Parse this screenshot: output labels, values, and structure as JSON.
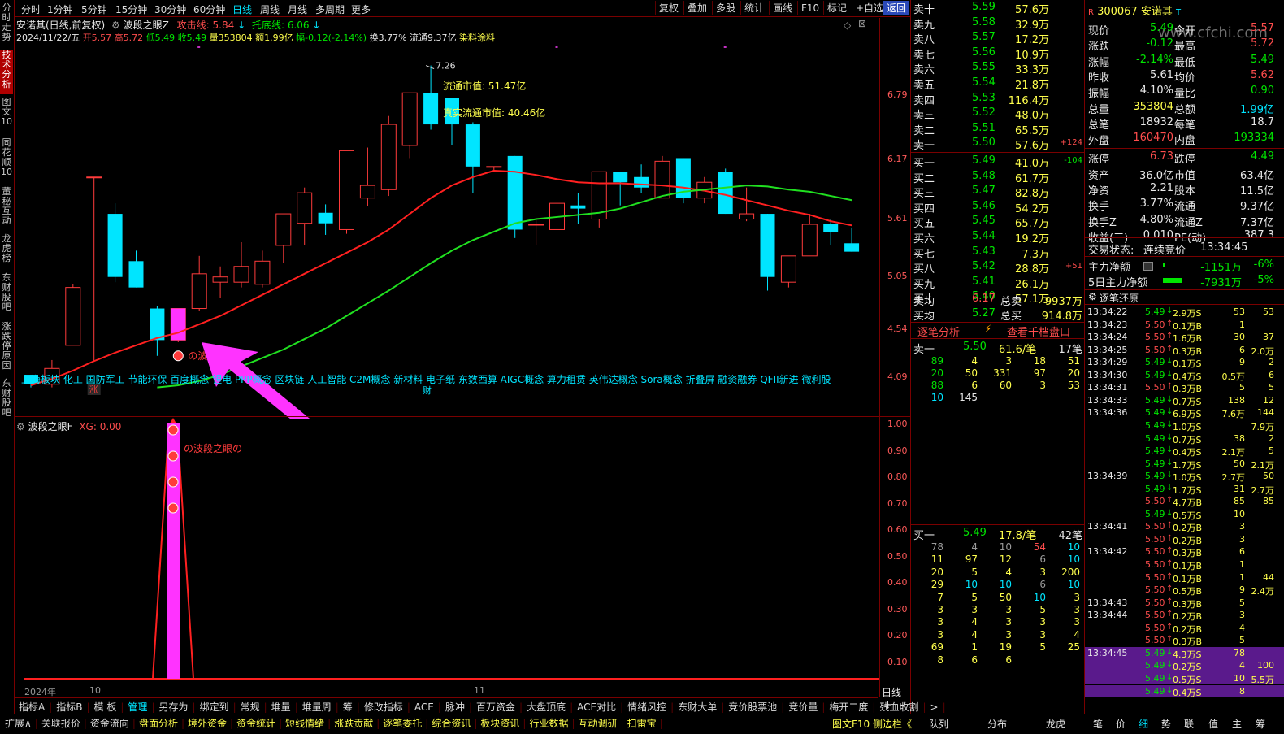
{
  "left_tabs": [
    "分时走势",
    "技术分析",
    "图文10",
    "同花顺10",
    "董秘互动",
    "龙虎榜",
    "东财股吧",
    "涨跌停原因",
    "东财股吧"
  ],
  "period_buttons": [
    "分时",
    "1分钟",
    "5分钟",
    "15分钟",
    "30分钟",
    "60分钟",
    "日线",
    "周线",
    "月线",
    "多周期",
    "更多"
  ],
  "right_buttons": [
    "复权",
    "叠加",
    "多股",
    "统计",
    "画线",
    "F10",
    "标记",
    "+自选",
    "返回"
  ],
  "stock_header": {
    "name": "安诺其(日线,前复权)",
    "indicator": "波段之眼Z",
    "attack_label": "攻击线: 5.84",
    "support_label": "托底线: 6.06",
    "date": "2024/11/22/五",
    "open": "开5.57",
    "high": "高5.72",
    "low": "低5.49",
    "close": "收5.49",
    "volume": "量353804",
    "amount": "额1.99亿",
    "change": "幅-0.12(-2.14%)",
    "turnover": "换3.77%",
    "float": "流通9.37亿",
    "concept": "染料涂料"
  },
  "annotations": {
    "float_mv": "流通市值: 51.47亿",
    "real_float_mv": "真实流通市值: 40.46亿",
    "high_mark": "7.26",
    "signal": "の波段之眼の",
    "zhang": "涨",
    "lower_panel_title": "波段之眼F",
    "lower_panel_xg": "XG: 0.00",
    "year": "2024年",
    "month_oct": "10",
    "month_nov": "11",
    "period": "日线"
  },
  "concepts_line": "上海板块 化工 国防军工 节能环保 百度概念 锂电 PPP概念 区块链 人工智能 C2M概念 新材料 电子纸 东数西算 AIGC概念 算力租赁 英伟达概念 Sora概念 折叠屏 融资融券 QFII新进 微利股",
  "concepts_line2": "财",
  "price_axis": [
    "6.79",
    "6.17",
    "5.61",
    "5.05",
    "4.54",
    "4.09"
  ],
  "lower_axis": [
    "1.00",
    "0.90",
    "0.80",
    "0.70",
    "0.60",
    "0.50",
    "0.40",
    "0.30",
    "0.20",
    "0.10"
  ],
  "candles": [
    {
      "o": 4.32,
      "c": 4.23,
      "h": 4.32,
      "l": 4.2
    },
    {
      "o": 4.23,
      "c": 4.38,
      "h": 4.46,
      "l": 4.2
    },
    {
      "o": 4.6,
      "c": 5.15,
      "h": 5.18,
      "l": 4.6
    },
    {
      "o": 6.2,
      "c": 6.2,
      "h": 6.2,
      "l": 4.45
    },
    {
      "o": 5.85,
      "c": 5.25,
      "h": 5.95,
      "l": 5.2
    },
    {
      "o": 5.4,
      "c": 5.15,
      "h": 5.5,
      "l": 5.15
    },
    {
      "o": 4.95,
      "c": 4.65,
      "h": 4.97,
      "l": 4.5
    },
    {
      "o": 4.65,
      "c": 4.95,
      "h": 4.95,
      "l": 4.63
    },
    {
      "o": 4.95,
      "c": 5.28,
      "h": 5.45,
      "l": 4.93
    },
    {
      "o": 5.2,
      "c": 5.25,
      "h": 5.35,
      "l": 5.05
    },
    {
      "o": 5.2,
      "c": 5.35,
      "h": 5.58,
      "l": 5.15
    },
    {
      "o": 5.18,
      "c": 5.4,
      "h": 5.5,
      "l": 5.15
    },
    {
      "o": 5.55,
      "c": 5.85,
      "h": 5.85,
      "l": 5.38
    },
    {
      "o": 5.76,
      "c": 6.05,
      "h": 6.1,
      "l": 5.55
    },
    {
      "o": 5.86,
      "c": 5.76,
      "h": 5.94,
      "l": 5.65
    },
    {
      "o": 5.7,
      "c": 6.45,
      "h": 6.45,
      "l": 5.66
    },
    {
      "o": 6.0,
      "c": 6.12,
      "h": 6.48,
      "l": 5.92
    },
    {
      "o": 6.08,
      "c": 6.7,
      "h": 6.78,
      "l": 6.02
    },
    {
      "o": 6.5,
      "c": 7.0,
      "h": 7.0,
      "l": 6.38
    },
    {
      "o": 7.0,
      "c": 6.7,
      "h": 7.26,
      "l": 6.65
    },
    {
      "o": 6.95,
      "c": 6.7,
      "h": 6.95,
      "l": 6.5
    },
    {
      "o": 6.7,
      "c": 6.3,
      "h": 6.72,
      "l": 6.05
    },
    {
      "o": 6.3,
      "c": 6.3,
      "h": 6.3,
      "l": 6.25
    },
    {
      "o": 6.4,
      "c": 5.7,
      "h": 6.4,
      "l": 5.62
    },
    {
      "o": 5.75,
      "c": 5.75,
      "h": 5.8,
      "l": 5.55
    },
    {
      "o": 5.7,
      "c": 5.95,
      "h": 5.95,
      "l": 5.65
    },
    {
      "o": 5.93,
      "c": 5.9,
      "h": 6.05,
      "l": 5.75
    },
    {
      "o": 5.8,
      "c": 6.25,
      "h": 6.25,
      "l": 5.72
    },
    {
      "o": 6.25,
      "c": 6.15,
      "h": 6.25,
      "l": 5.93
    },
    {
      "o": 6.2,
      "c": 6.1,
      "h": 6.32,
      "l": 6.05
    },
    {
      "o": 6.0,
      "c": 6.35,
      "h": 6.4,
      "l": 6.0
    },
    {
      "o": 6.38,
      "c": 6.0,
      "h": 6.38,
      "l": 5.95
    },
    {
      "o": 6.0,
      "c": 6.15,
      "h": 6.2,
      "l": 5.95
    },
    {
      "o": 6.25,
      "c": 5.85,
      "h": 6.28,
      "l": 5.85
    },
    {
      "o": 5.8,
      "c": 5.85,
      "h": 6.1,
      "l": 5.78
    },
    {
      "o": 5.85,
      "c": 5.25,
      "h": 5.85,
      "l": 5.12
    },
    {
      "o": 5.2,
      "c": 5.45,
      "h": 5.45,
      "l": 5.15
    },
    {
      "o": 5.45,
      "c": 5.75,
      "h": 5.85,
      "l": 5.45
    },
    {
      "o": 5.75,
      "c": 5.68,
      "h": 5.8,
      "l": 5.55
    },
    {
      "o": 5.57,
      "c": 5.49,
      "h": 5.72,
      "l": 5.49
    }
  ],
  "ma_red": [
    4.22,
    4.28,
    4.36,
    4.45,
    4.53,
    4.6,
    4.67,
    4.72,
    4.8,
    4.88,
    4.98,
    5.08,
    5.18,
    5.28,
    5.38,
    5.48,
    5.58,
    5.7,
    5.85,
    6.0,
    6.12,
    6.2,
    6.26,
    6.25,
    6.22,
    6.18,
    6.15,
    6.14,
    6.14,
    6.13,
    6.12,
    6.1,
    6.07,
    6.03,
    5.98,
    5.93,
    5.88,
    5.84,
    5.78,
    5.74
  ],
  "ma_green": [
    null,
    null,
    null,
    null,
    null,
    null,
    4.2,
    4.22,
    4.26,
    4.32,
    4.4,
    4.48,
    4.56,
    4.66,
    4.76,
    4.88,
    5.0,
    5.12,
    5.25,
    5.38,
    5.5,
    5.6,
    5.68,
    5.76,
    5.8,
    5.82,
    5.84,
    5.86,
    5.9,
    5.96,
    6.02,
    6.06,
    6.08,
    6.1,
    6.12,
    6.11,
    6.08,
    6.06,
    6.02,
    5.98
  ],
  "quote": {
    "code": "300067",
    "name": "安诺其",
    "sell": [
      {
        "label": "卖十",
        "price": "5.59",
        "vol": "57.6万",
        "chg": ""
      },
      {
        "label": "卖九",
        "price": "5.58",
        "vol": "32.9万",
        "chg": ""
      },
      {
        "label": "卖八",
        "price": "5.57",
        "vol": "17.2万",
        "chg": ""
      },
      {
        "label": "卖七",
        "price": "5.56",
        "vol": "10.9万",
        "chg": ""
      },
      {
        "label": "卖六",
        "price": "5.55",
        "vol": "33.3万",
        "chg": ""
      },
      {
        "label": "卖五",
        "price": "5.54",
        "vol": "21.8万",
        "chg": ""
      },
      {
        "label": "卖四",
        "price": "5.53",
        "vol": "116.4万",
        "chg": ""
      },
      {
        "label": "卖三",
        "price": "5.52",
        "vol": "48.0万",
        "chg": ""
      },
      {
        "label": "卖二",
        "price": "5.51",
        "vol": "65.5万",
        "chg": ""
      },
      {
        "label": "卖一",
        "price": "5.50",
        "vol": "57.6万",
        "chg": "+124"
      }
    ],
    "buy": [
      {
        "label": "买一",
        "price": "5.49",
        "vol": "41.0万",
        "chg": "-104"
      },
      {
        "label": "买二",
        "price": "5.48",
        "vol": "61.7万",
        "chg": ""
      },
      {
        "label": "买三",
        "price": "5.47",
        "vol": "82.8万",
        "chg": ""
      },
      {
        "label": "买四",
        "price": "5.46",
        "vol": "54.2万",
        "chg": ""
      },
      {
        "label": "买五",
        "price": "5.45",
        "vol": "65.7万",
        "chg": ""
      },
      {
        "label": "买六",
        "price": "5.44",
        "vol": "19.2万",
        "chg": ""
      },
      {
        "label": "买七",
        "price": "5.43",
        "vol": "7.3万",
        "chg": ""
      },
      {
        "label": "买八",
        "price": "5.42",
        "vol": "28.8万",
        "chg": "+51"
      },
      {
        "label": "买九",
        "price": "5.41",
        "vol": "26.1万",
        "chg": ""
      },
      {
        "label": "买十",
        "price": "5.40",
        "vol": "57.1万",
        "chg": ""
      }
    ],
    "avg_sell": {
      "label": "卖均",
      "price": "6.17",
      "tlabel": "总卖",
      "total": "9937万"
    },
    "avg_buy": {
      "label": "买均",
      "price": "5.27",
      "tlabel": "总买",
      "total": "914.8万"
    },
    "tick_links": [
      "逐笔分析",
      "查看千档盘口"
    ],
    "sell1_summary": {
      "label": "卖一",
      "price": "5.50",
      "per": "61.6/笔",
      "count": "17笔"
    },
    "sell1_queue": [
      [
        "89",
        "4",
        "3",
        "18",
        "51"
      ],
      [
        "20",
        "50",
        "331",
        "97",
        "20"
      ],
      [
        "88",
        "6",
        "60",
        "3",
        "53"
      ],
      [
        "10",
        "145",
        "",
        "",
        ""
      ]
    ],
    "buy1_summary": {
      "label": "买一",
      "price": "5.49",
      "per": "17.8/笔",
      "count": "42笔"
    },
    "buy1_queue": [
      [
        "78",
        "4",
        "10",
        "54",
        "10"
      ],
      [
        "11",
        "97",
        "12",
        "6",
        "10"
      ],
      [
        "20",
        "5",
        "4",
        "3",
        "200"
      ],
      [
        "29",
        "10",
        "10",
        "6",
        "10"
      ],
      [
        "7",
        "5",
        "50",
        "10",
        "3"
      ],
      [
        "3",
        "3",
        "3",
        "5",
        "3"
      ],
      [
        "3",
        "4",
        "3",
        "3",
        "3"
      ],
      [
        "3",
        "4",
        "3",
        "3",
        "4"
      ],
      [
        "69",
        "1",
        "19",
        "5",
        "25"
      ],
      [
        "8",
        "6",
        "6",
        "",
        ""
      ]
    ]
  },
  "stats": [
    [
      "现价",
      "5.49",
      "今开",
      "5.57"
    ],
    [
      "涨跌",
      "-0.12",
      "最高",
      "5.72"
    ],
    [
      "涨幅",
      "-2.14%",
      "最低",
      "5.49"
    ],
    [
      "昨收",
      "5.61",
      "均价",
      "5.62"
    ],
    [
      "振幅",
      "4.10%",
      "量比",
      "0.90"
    ],
    [
      "总量",
      "353804",
      "总额",
      "1.99亿"
    ],
    [
      "总笔",
      "18932",
      "每笔",
      "18.7"
    ],
    [
      "外盘",
      "160470",
      "内盘",
      "193334"
    ],
    [
      "涨停",
      "6.73",
      "跌停",
      "4.49"
    ],
    [
      "资产",
      "36.0亿",
      "市值",
      "63.4亿"
    ],
    [
      "净资",
      "2.21",
      "股本",
      "11.5亿"
    ],
    [
      "换手",
      "3.77%",
      "流通",
      "9.37亿"
    ],
    [
      "换手Z",
      "4.80%",
      "流通Z",
      "7.37亿"
    ],
    [
      "收益(三)",
      "0.010",
      "PE(动)",
      "387.3"
    ]
  ],
  "trade_status": {
    "label": "交易状态:",
    "value": "连续竞价",
    "time": "13:34:45"
  },
  "money_flow": [
    {
      "label": "主力净额",
      "value": "-1151万",
      "pct": "-6%"
    },
    {
      "label": "5日主力净额",
      "value": "-7931万",
      "pct": "-5%"
    }
  ],
  "tick_title": "逐笔还原",
  "ticks": [
    {
      "t": "13:34:22",
      "p": "5.49",
      "v": "2.9万S",
      "a": "53",
      "b": "53"
    },
    {
      "t": "13:34:23",
      "p": "5.50",
      "v": "0.1万B",
      "a": "1",
      "b": ""
    },
    {
      "t": "13:34:24",
      "p": "5.50",
      "v": "1.6万B",
      "a": "30",
      "b": "37"
    },
    {
      "t": "13:34:25",
      "p": "5.50",
      "v": "0.3万B",
      "a": "6",
      "b": "2.0万"
    },
    {
      "t": "13:34:29",
      "p": "5.49",
      "v": "0.1万S",
      "a": "9",
      "b": "2"
    },
    {
      "t": "13:34:30",
      "p": "5.49",
      "v": "0.4万S",
      "a": "0.5万",
      "b": "6"
    },
    {
      "t": "13:34:31",
      "p": "5.50",
      "v": "0.3万B",
      "a": "5",
      "b": "5"
    },
    {
      "t": "13:34:33",
      "p": "5.49",
      "v": "0.7万S",
      "a": "138",
      "b": "12"
    },
    {
      "t": "13:34:36",
      "p": "5.49",
      "v": "6.9万S",
      "a": "7.6万",
      "b": "144"
    },
    {
      "t": "",
      "p": "5.49",
      "v": "1.0万S",
      "a": "",
      "b": "7.9万"
    },
    {
      "t": "",
      "p": "5.49",
      "v": "0.7万S",
      "a": "38",
      "b": "2"
    },
    {
      "t": "",
      "p": "5.49",
      "v": "0.4万S",
      "a": "2.1万",
      "b": "5"
    },
    {
      "t": "",
      "p": "5.49",
      "v": "1.7万S",
      "a": "50",
      "b": "2.1万"
    },
    {
      "t": "13:34:39",
      "p": "5.49",
      "v": "1.0万S",
      "a": "2.7万",
      "b": "50"
    },
    {
      "t": "",
      "p": "5.49",
      "v": "1.7万S",
      "a": "31",
      "b": "2.7万"
    },
    {
      "t": "",
      "p": "5.50",
      "v": "4.7万B",
      "a": "85",
      "b": "85"
    },
    {
      "t": "",
      "p": "5.49",
      "v": "0.5万S",
      "a": "10",
      "b": ""
    },
    {
      "t": "13:34:41",
      "p": "5.50",
      "v": "0.2万B",
      "a": "3",
      "b": ""
    },
    {
      "t": "",
      "p": "5.50",
      "v": "0.2万B",
      "a": "3",
      "b": ""
    },
    {
      "t": "13:34:42",
      "p": "5.50",
      "v": "0.3万B",
      "a": "6",
      "b": ""
    },
    {
      "t": "",
      "p": "5.50",
      "v": "0.1万B",
      "a": "1",
      "b": ""
    },
    {
      "t": "",
      "p": "5.50",
      "v": "0.1万B",
      "a": "1",
      "b": "44"
    },
    {
      "t": "",
      "p": "5.50",
      "v": "0.5万B",
      "a": "9",
      "b": "2.4万"
    },
    {
      "t": "13:34:43",
      "p": "5.50",
      "v": "0.3万B",
      "a": "5",
      "b": ""
    },
    {
      "t": "13:34:44",
      "p": "5.50",
      "v": "0.2万B",
      "a": "3",
      "b": ""
    },
    {
      "t": "",
      "p": "5.50",
      "v": "0.2万B",
      "a": "4",
      "b": ""
    },
    {
      "t": "",
      "p": "5.50",
      "v": "0.3万B",
      "a": "5",
      "b": ""
    },
    {
      "t": "13:34:45",
      "p": "5.49",
      "v": "4.3万S",
      "a": "78",
      "b": ""
    },
    {
      "t": "",
      "p": "5.49",
      "v": "0.2万S",
      "a": "4",
      "b": "100"
    },
    {
      "t": "",
      "p": "5.49",
      "v": "0.5万S",
      "a": "10",
      "b": "5.5万"
    },
    {
      "t": "",
      "p": "5.49",
      "v": "0.4万S",
      "a": "8",
      "b": ""
    }
  ],
  "indicator_tabs": [
    "指标A",
    "指标B",
    "模 板",
    "管理",
    "另存为",
    "绑定到",
    "常规",
    "堆量",
    "堆量周",
    "筹",
    "修改指标",
    "ACE",
    "脉冲",
    "百万资金",
    "大盘顶底",
    "ACE对比",
    "情绪风控",
    "东财大单",
    "竞价股票池",
    "竞价量",
    "梅开二度",
    "残血收割",
    ">"
  ],
  "bottom_tabs": [
    "扩展∧",
    "关联报价",
    "资金流向",
    "盘面分析",
    "境外资金",
    "资金统计",
    "短线情绪",
    "涨跌贡献",
    "逐笔委托",
    "综合资讯",
    "板块资讯",
    "行业数据",
    "互动调研",
    "扫雷宝"
  ],
  "bottom_right": [
    "图文F10",
    "侧边栏《",
    "队列",
    "分布",
    "龙虎",
    "笔",
    "价",
    "细",
    "势",
    "联",
    "值",
    "主",
    "筹"
  ],
  "watermark": "www.cfchi.com"
}
